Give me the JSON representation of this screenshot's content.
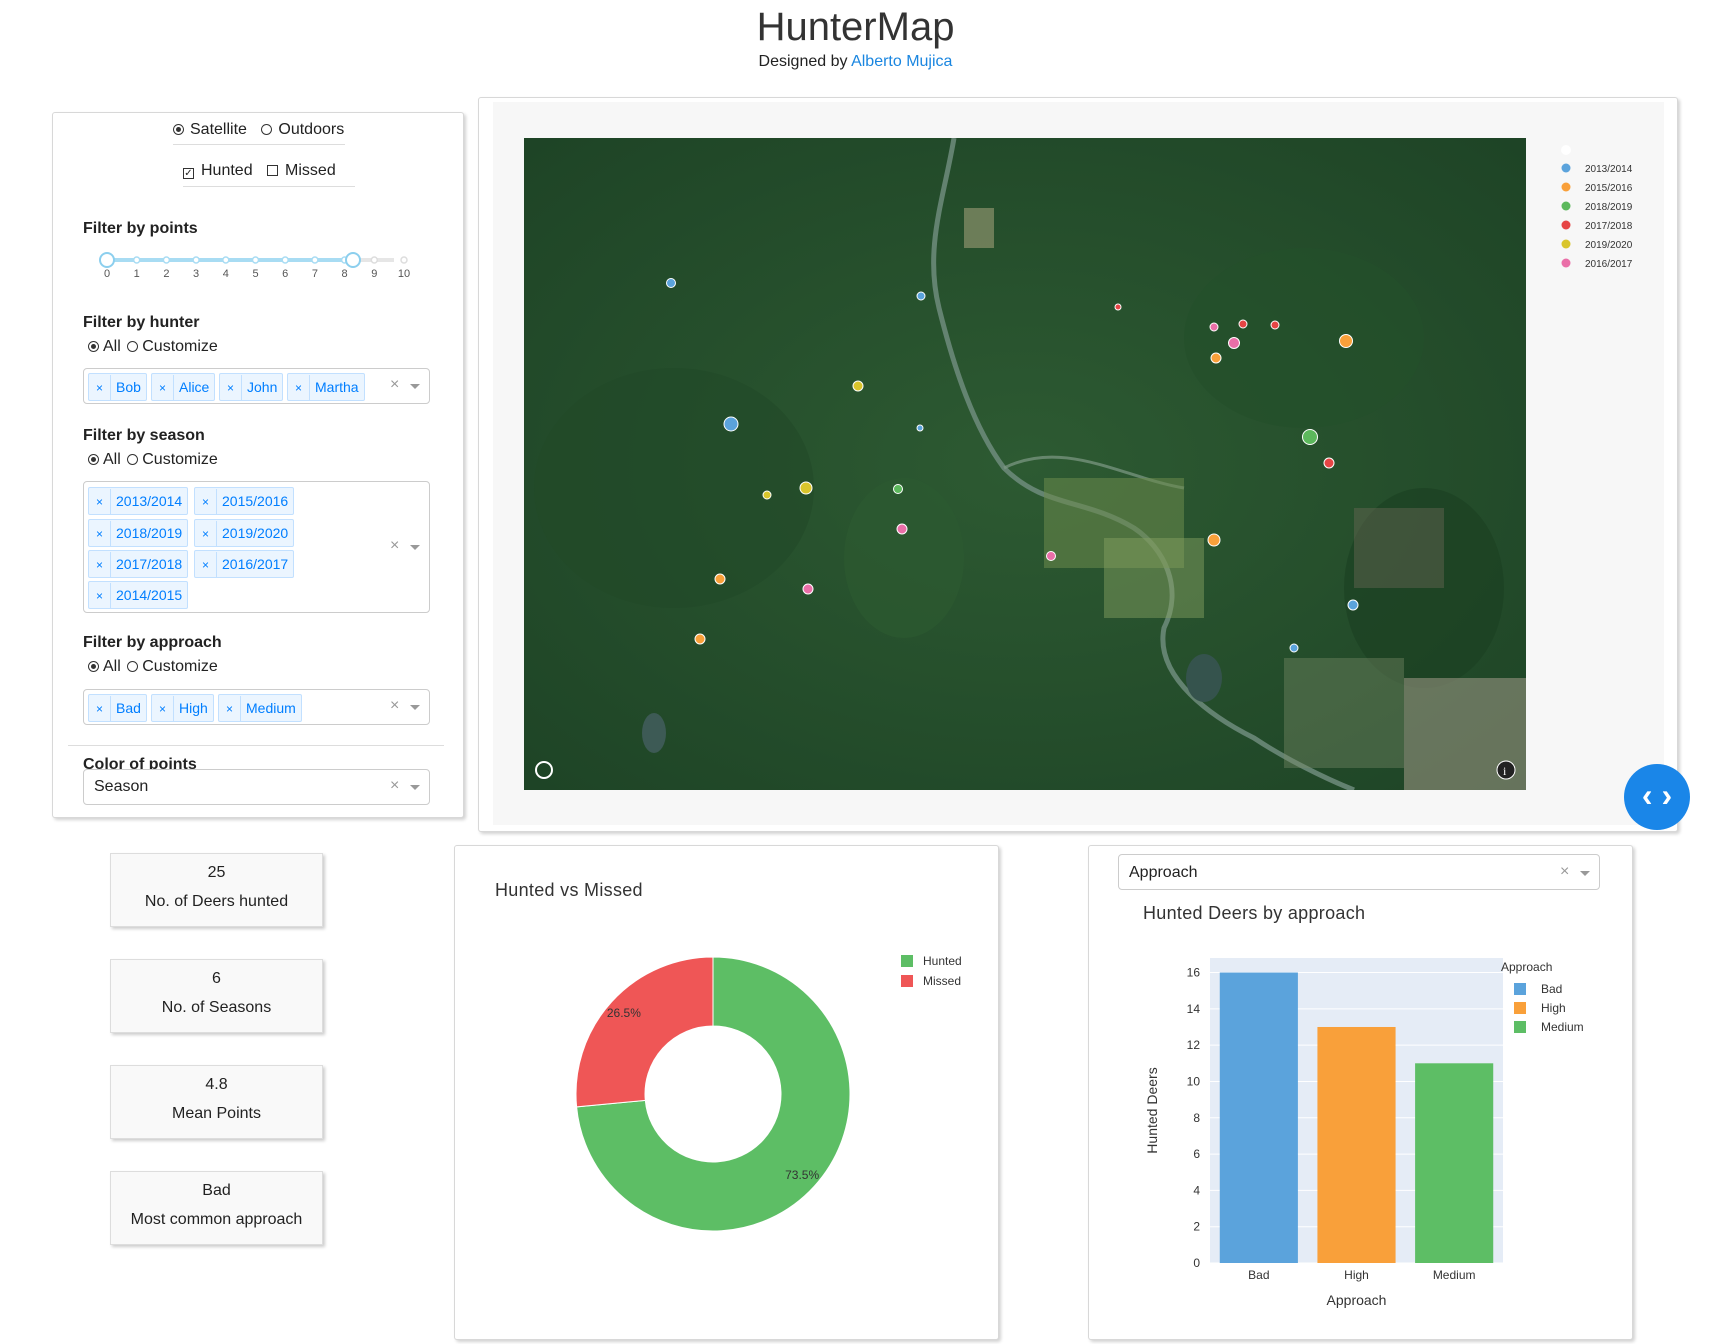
{
  "header": {
    "title": "HunterMap",
    "subtitle_prefix": "Designed by ",
    "author": "Alberto Mujica"
  },
  "controls": {
    "basemap": {
      "options": [
        "Satellite",
        "Outdoors"
      ],
      "selected": "Satellite"
    },
    "status": {
      "options": [
        "Hunted",
        "Missed"
      ],
      "checked": [
        "Hunted"
      ]
    },
    "points_filter": {
      "label": "Filter by points",
      "ticks": [
        "0",
        "1",
        "2",
        "3",
        "4",
        "5",
        "6",
        "7",
        "8",
        "9",
        "10"
      ],
      "range": [
        0,
        8
      ]
    },
    "hunter_filter": {
      "label": "Filter by hunter",
      "radio": [
        "All",
        "Customize"
      ],
      "selected": "All",
      "tags": [
        "Bob",
        "Alice",
        "John",
        "Martha"
      ]
    },
    "season_filter": {
      "label": "Filter by season",
      "radio": [
        "All",
        "Customize"
      ],
      "selected": "All",
      "tags": [
        "2013/2014",
        "2015/2016",
        "2018/2019",
        "2019/2020",
        "2017/2018",
        "2016/2017",
        "2014/2015"
      ]
    },
    "approach_filter": {
      "label": "Filter by approach",
      "radio": [
        "All",
        "Customize"
      ],
      "selected": "All",
      "tags": [
        "Bad",
        "High",
        "Medium"
      ]
    },
    "color_by": {
      "label": "Color of points",
      "value": "Season"
    }
  },
  "map": {
    "legend": [
      {
        "label": "2013/2014",
        "color": "#5ba3dc"
      },
      {
        "label": "2015/2016",
        "color": "#f9a03a"
      },
      {
        "label": "2018/2019",
        "color": "#5cb85c"
      },
      {
        "label": "2017/2018",
        "color": "#e64545"
      },
      {
        "label": "2019/2020",
        "color": "#d9c52c"
      },
      {
        "label": "2016/2017",
        "color": "#ea6fa8"
      }
    ]
  },
  "stats": [
    {
      "value": "25",
      "label": "No. of Deers hunted"
    },
    {
      "value": "6",
      "label": "No. of Seasons"
    },
    {
      "value": "4.8",
      "label": "Mean Points"
    },
    {
      "value": "Bad",
      "label": "Most common approach"
    }
  ],
  "pie_panel": {
    "title": "Hunted vs Missed"
  },
  "bar_panel": {
    "dropdown_value": "Approach",
    "title": "Hunted Deers by approach"
  },
  "chart_data": [
    {
      "type": "pie",
      "title": "Hunted vs Missed",
      "labels": [
        "Hunted",
        "Missed"
      ],
      "values": [
        73.5,
        26.5
      ],
      "value_labels": [
        "73.5%",
        "26.5%"
      ],
      "colors": [
        "#5dbe65",
        "#ef5656"
      ],
      "hole": 0.5,
      "legend_position": "top-right"
    },
    {
      "type": "bar",
      "title": "Hunted Deers by approach",
      "categories": [
        "Bad",
        "High",
        "Medium"
      ],
      "values": [
        16,
        13,
        11
      ],
      "colors": [
        "#5ba3dc",
        "#f9a03a",
        "#5dbe65"
      ],
      "xlabel": "Approach",
      "ylabel": "Hunted Deers",
      "ylim": [
        0,
        16.8
      ],
      "yticks": [
        "0",
        "2",
        "4",
        "6",
        "8",
        "10",
        "12",
        "14",
        "16"
      ],
      "legend_title": "Approach",
      "legend": [
        "Bad",
        "High",
        "Medium"
      ],
      "legend_position": "top-right"
    }
  ]
}
